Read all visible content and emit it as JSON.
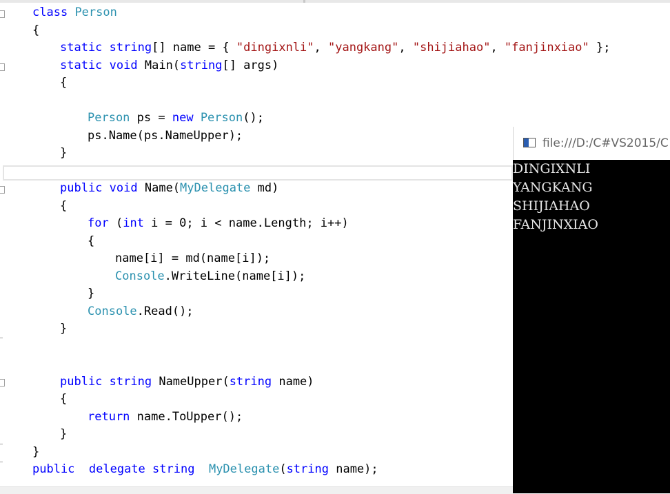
{
  "colors": {
    "keyword": "#0000ff",
    "type": "#2b91af",
    "string": "#a31515",
    "plain": "#000000"
  },
  "code": {
    "lines": [
      {
        "indent": 0,
        "tokens": [
          {
            "t": "kw",
            "v": "class"
          },
          {
            "t": "p",
            "v": " "
          },
          {
            "t": "ty",
            "v": "Person"
          }
        ]
      },
      {
        "indent": 0,
        "tokens": [
          {
            "t": "p",
            "v": "{"
          }
        ]
      },
      {
        "indent": 1,
        "tokens": [
          {
            "t": "kw",
            "v": "static"
          },
          {
            "t": "p",
            "v": " "
          },
          {
            "t": "kw",
            "v": "string"
          },
          {
            "t": "p",
            "v": "[] name = { "
          },
          {
            "t": "str",
            "v": "\"dingixnli\""
          },
          {
            "t": "p",
            "v": ", "
          },
          {
            "t": "str",
            "v": "\"yangkang\""
          },
          {
            "t": "p",
            "v": ", "
          },
          {
            "t": "str",
            "v": "\"shijiahao\""
          },
          {
            "t": "p",
            "v": ", "
          },
          {
            "t": "str",
            "v": "\"fanjinxiao\""
          },
          {
            "t": "p",
            "v": " };"
          }
        ]
      },
      {
        "indent": 1,
        "tokens": [
          {
            "t": "kw",
            "v": "static"
          },
          {
            "t": "p",
            "v": " "
          },
          {
            "t": "kw",
            "v": "void"
          },
          {
            "t": "p",
            "v": " Main("
          },
          {
            "t": "kw",
            "v": "string"
          },
          {
            "t": "p",
            "v": "[] args)"
          }
        ]
      },
      {
        "indent": 1,
        "tokens": [
          {
            "t": "p",
            "v": "{"
          }
        ]
      },
      {
        "indent": 0,
        "tokens": []
      },
      {
        "indent": 2,
        "tokens": [
          {
            "t": "ty",
            "v": "Person"
          },
          {
            "t": "p",
            "v": " ps = "
          },
          {
            "t": "kw",
            "v": "new"
          },
          {
            "t": "p",
            "v": " "
          },
          {
            "t": "ty",
            "v": "Person"
          },
          {
            "t": "p",
            "v": "();"
          }
        ]
      },
      {
        "indent": 2,
        "tokens": [
          {
            "t": "p",
            "v": "ps.Name(ps.NameUpper);"
          }
        ]
      },
      {
        "indent": 1,
        "tokens": [
          {
            "t": "p",
            "v": "}"
          }
        ]
      },
      {
        "indent": 0,
        "tokens": []
      },
      {
        "indent": 1,
        "tokens": [
          {
            "t": "kw",
            "v": "public"
          },
          {
            "t": "p",
            "v": " "
          },
          {
            "t": "kw",
            "v": "void"
          },
          {
            "t": "p",
            "v": " Name("
          },
          {
            "t": "ty",
            "v": "MyDelegate"
          },
          {
            "t": "p",
            "v": " md)"
          }
        ]
      },
      {
        "indent": 1,
        "tokens": [
          {
            "t": "p",
            "v": "{"
          }
        ]
      },
      {
        "indent": 2,
        "tokens": [
          {
            "t": "kw",
            "v": "for"
          },
          {
            "t": "p",
            "v": " ("
          },
          {
            "t": "kw",
            "v": "int"
          },
          {
            "t": "p",
            "v": " i = 0; i < name.Length; i++)"
          }
        ]
      },
      {
        "indent": 2,
        "tokens": [
          {
            "t": "p",
            "v": "{"
          }
        ]
      },
      {
        "indent": 3,
        "tokens": [
          {
            "t": "p",
            "v": "name[i] = md(name[i]);"
          }
        ]
      },
      {
        "indent": 3,
        "tokens": [
          {
            "t": "ty",
            "v": "Console"
          },
          {
            "t": "p",
            "v": ".WriteLine(name[i]);"
          }
        ]
      },
      {
        "indent": 2,
        "tokens": [
          {
            "t": "p",
            "v": "}"
          }
        ]
      },
      {
        "indent": 2,
        "tokens": [
          {
            "t": "ty",
            "v": "Console"
          },
          {
            "t": "p",
            "v": ".Read();"
          }
        ]
      },
      {
        "indent": 1,
        "tokens": [
          {
            "t": "p",
            "v": "}"
          }
        ]
      },
      {
        "indent": 0,
        "tokens": []
      },
      {
        "indent": 0,
        "tokens": []
      },
      {
        "indent": 1,
        "tokens": [
          {
            "t": "kw",
            "v": "public"
          },
          {
            "t": "p",
            "v": " "
          },
          {
            "t": "kw",
            "v": "string"
          },
          {
            "t": "p",
            "v": " NameUpper("
          },
          {
            "t": "kw",
            "v": "string"
          },
          {
            "t": "p",
            "v": " name)"
          }
        ]
      },
      {
        "indent": 1,
        "tokens": [
          {
            "t": "p",
            "v": "{"
          }
        ]
      },
      {
        "indent": 2,
        "tokens": [
          {
            "t": "kw",
            "v": "return"
          },
          {
            "t": "p",
            "v": " name.ToUpper();"
          }
        ]
      },
      {
        "indent": 1,
        "tokens": [
          {
            "t": "p",
            "v": "}"
          }
        ]
      },
      {
        "indent": 0,
        "tokens": [
          {
            "t": "p",
            "v": "}"
          }
        ]
      },
      {
        "indent": 0,
        "tokens": [
          {
            "t": "kw",
            "v": "public"
          },
          {
            "t": "p",
            "v": "  "
          },
          {
            "t": "kw",
            "v": "delegate"
          },
          {
            "t": "p",
            "v": " "
          },
          {
            "t": "kw",
            "v": "string"
          },
          {
            "t": "p",
            "v": "  "
          },
          {
            "t": "ty",
            "v": "MyDelegate"
          },
          {
            "t": "p",
            "v": "("
          },
          {
            "t": "kw",
            "v": "string"
          },
          {
            "t": "p",
            "v": " name);"
          }
        ]
      }
    ]
  },
  "console": {
    "icon": "console-window-icon",
    "title": "file:///D:/C#VS2015/C",
    "output": [
      "DINGIXNLI",
      "YANGKANG",
      "SHIJIAHAO",
      "FANJINXIAO"
    ]
  }
}
